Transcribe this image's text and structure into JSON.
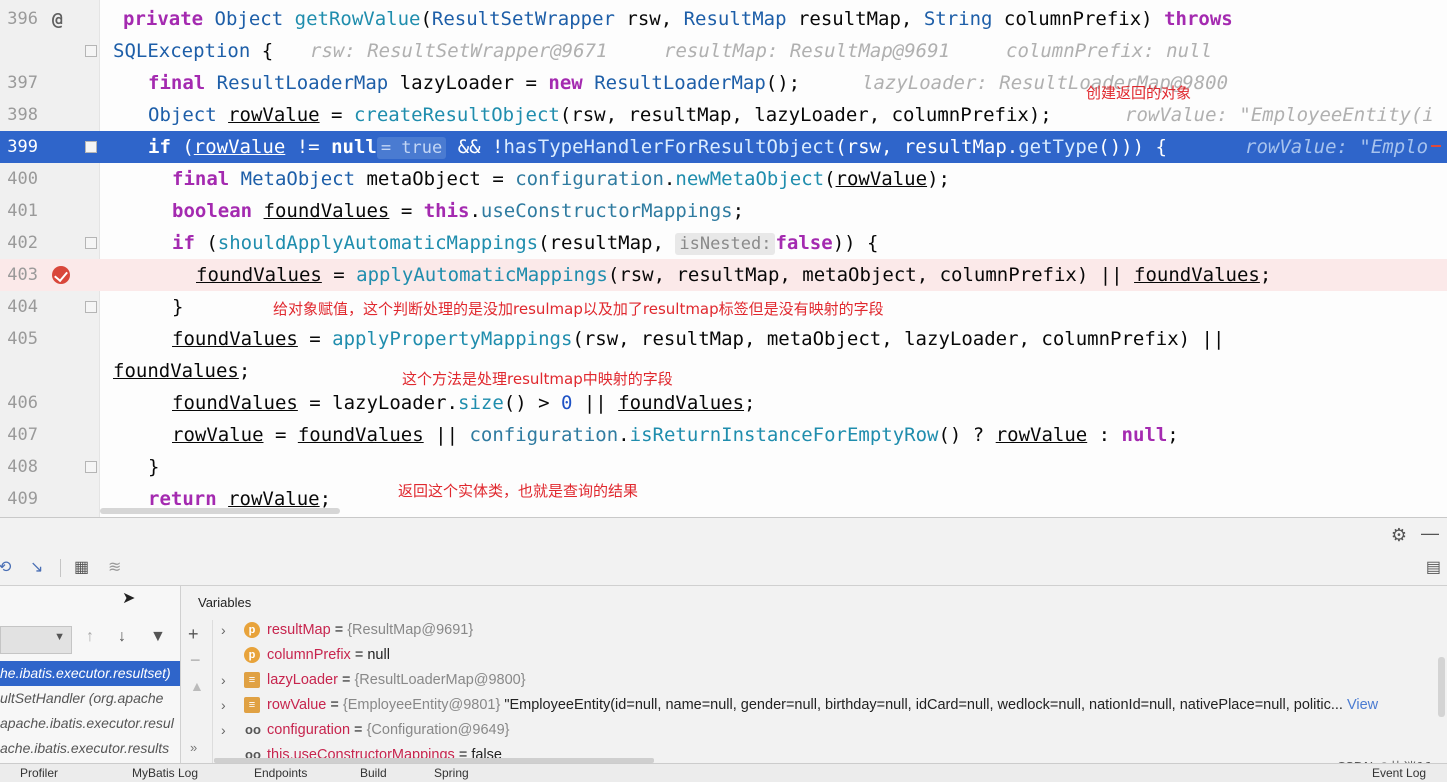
{
  "editor": {
    "lines": {
      "l396": "396",
      "l397": "397",
      "l398": "398",
      "l399": "399",
      "l400": "400",
      "l401": "401",
      "l402": "402",
      "l403": "403",
      "l404": "404",
      "l405": "405",
      "l406": "406",
      "l407": "407",
      "l408": "408",
      "l409": "409"
    },
    "hints": {
      "rsw": "rsw: ResultSetWrapper@9671",
      "resultMap": "resultMap: ResultMap@9691",
      "columnPrefix": "columnPrefix: null",
      "lazyLoader": "lazyLoader: ResultLoaderMap@9800",
      "rowValue398": "rowValue: \"EmployeeEntity(i",
      "rowValue399": "rowValue: \"Emplo",
      "inlay_true": "= true",
      "inlay_isNested": "isNested:"
    },
    "annotations": {
      "create": "创建返回的对象",
      "assign": "给对象赋值，这个判断处理的是没加resulmap以及加了resultmap标签但是没有映射的字段",
      "method": "这个方法是处理resultmap中映射的字段",
      "return": "返回这个实体类，也就是查询的结果"
    }
  },
  "debug": {
    "variables_title": "Variables",
    "frames": [
      "he.ibatis.executor.resultset)",
      "ultSetHandler (org.apache",
      "apache.ibatis.executor.resul",
      "ache.ibatis.executor.results"
    ],
    "variables": [
      {
        "name": "resultMap",
        "eq": " = ",
        "value": "{ResultMap@9691}",
        "icon": "p"
      },
      {
        "name": "columnPrefix",
        "eq": " = ",
        "value": "null",
        "icon": "p"
      },
      {
        "name": "lazyLoader",
        "eq": " = ",
        "value": "{ResultLoaderMap@9800}",
        "icon": "field"
      },
      {
        "name": "rowValue",
        "eq": " = ",
        "value": "{EmployeeEntity@9801}",
        "extra": " \"EmployeeEntity(id=null, name=null, gender=null, birthday=null, idCard=null, wedlock=null, nationId=null, nativePlace=null, politic...",
        "link": " View",
        "icon": "field"
      },
      {
        "name": "configuration",
        "eq": " = ",
        "value": "{Configuration@9649}",
        "icon": "glasses"
      },
      {
        "name": "this.useConstructorMappings",
        "eq": " = ",
        "value": "false",
        "icon": "glasses"
      }
    ],
    "status_items": [
      "Profiler",
      "MyBatis Log",
      "Endpoints",
      "Build",
      "Spring",
      "Event Log"
    ],
    "watermark": "CSDN @执迷11"
  },
  "colors": {
    "exec_line": "#2f65ca",
    "breakpoint_line": "#fbe9e9",
    "annotation_red": "#e0282e",
    "keyword": "#a42ab0"
  }
}
